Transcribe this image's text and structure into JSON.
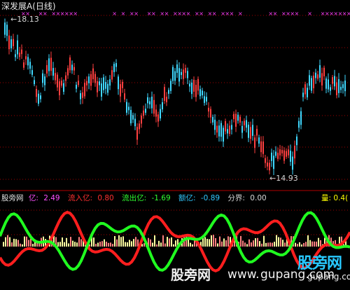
{
  "header": {
    "title": "深发展A(日线)"
  },
  "price_labels": {
    "high": "18.13",
    "low": "14.93",
    "high_arrow": "←",
    "low_arrow": "←"
  },
  "indicator": {
    "name": "股旁网",
    "items": [
      {
        "label": "亿:",
        "value": "2.49",
        "color": "#ff50ff"
      },
      {
        "label": "流入亿:",
        "value": "0.80",
        "color": "#ff3030"
      },
      {
        "label": "流出亿:",
        "value": "-1.69",
        "color": "#30ff30"
      },
      {
        "label": "额亿:",
        "value": "-0.89",
        "color": "#30c8ff"
      },
      {
        "label": "分界:",
        "value": "0.00",
        "color": "#d8d8d8"
      }
    ],
    "volume": {
      "label": "量:",
      "value": "0.4("
    }
  },
  "watermark": {
    "site_text": "股旁网",
    "domain_text": "www.",
    "domain_text2": "gupang.com",
    "logo_main": "股旁网",
    "logo_sub": "gupang.com"
  },
  "colors": {
    "up": "#ff4040",
    "down": "#40d8ff",
    "grid": "#a00000",
    "inflow": "#ff1e1e",
    "outflow": "#20ff20",
    "signal": "#ff40ff",
    "volume_bar": "#ffffa0"
  }
}
